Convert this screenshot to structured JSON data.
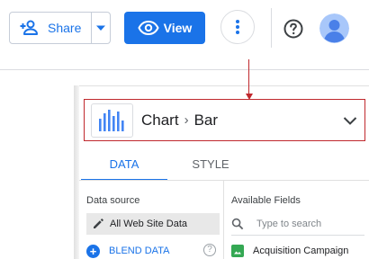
{
  "toolbar": {
    "share_label": "Share",
    "view_label": "View"
  },
  "chart_selector": {
    "category": "Chart",
    "type": "Bar"
  },
  "tabs": [
    {
      "label": "DATA",
      "active": true
    },
    {
      "label": "STYLE",
      "active": false
    }
  ],
  "data_source": {
    "title": "Data source",
    "name": "All Web Site Data",
    "blend_label": "BLEND DATA",
    "help_glyph": "?"
  },
  "available_fields": {
    "title": "Available Fields",
    "search_placeholder": "Type to search",
    "items": [
      {
        "name": "Acquisition Campaign"
      }
    ]
  },
  "colors": {
    "accent": "#1a73e8",
    "annotation": "#c0282d",
    "field_dimension": "#34a853"
  }
}
